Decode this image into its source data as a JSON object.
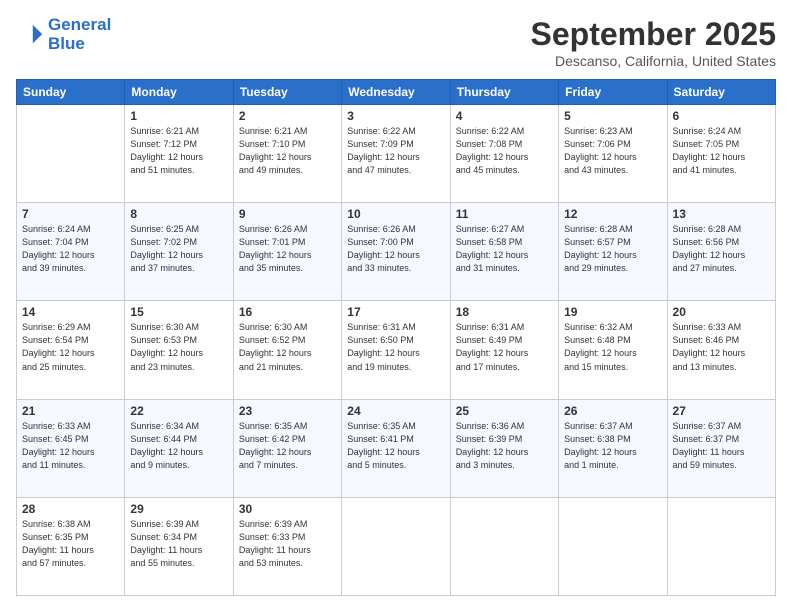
{
  "header": {
    "logo_line1": "General",
    "logo_line2": "Blue",
    "month": "September 2025",
    "location": "Descanso, California, United States"
  },
  "weekdays": [
    "Sunday",
    "Monday",
    "Tuesday",
    "Wednesday",
    "Thursday",
    "Friday",
    "Saturday"
  ],
  "weeks": [
    [
      {
        "day": "",
        "info": ""
      },
      {
        "day": "1",
        "info": "Sunrise: 6:21 AM\nSunset: 7:12 PM\nDaylight: 12 hours\nand 51 minutes."
      },
      {
        "day": "2",
        "info": "Sunrise: 6:21 AM\nSunset: 7:10 PM\nDaylight: 12 hours\nand 49 minutes."
      },
      {
        "day": "3",
        "info": "Sunrise: 6:22 AM\nSunset: 7:09 PM\nDaylight: 12 hours\nand 47 minutes."
      },
      {
        "day": "4",
        "info": "Sunrise: 6:22 AM\nSunset: 7:08 PM\nDaylight: 12 hours\nand 45 minutes."
      },
      {
        "day": "5",
        "info": "Sunrise: 6:23 AM\nSunset: 7:06 PM\nDaylight: 12 hours\nand 43 minutes."
      },
      {
        "day": "6",
        "info": "Sunrise: 6:24 AM\nSunset: 7:05 PM\nDaylight: 12 hours\nand 41 minutes."
      }
    ],
    [
      {
        "day": "7",
        "info": "Sunrise: 6:24 AM\nSunset: 7:04 PM\nDaylight: 12 hours\nand 39 minutes."
      },
      {
        "day": "8",
        "info": "Sunrise: 6:25 AM\nSunset: 7:02 PM\nDaylight: 12 hours\nand 37 minutes."
      },
      {
        "day": "9",
        "info": "Sunrise: 6:26 AM\nSunset: 7:01 PM\nDaylight: 12 hours\nand 35 minutes."
      },
      {
        "day": "10",
        "info": "Sunrise: 6:26 AM\nSunset: 7:00 PM\nDaylight: 12 hours\nand 33 minutes."
      },
      {
        "day": "11",
        "info": "Sunrise: 6:27 AM\nSunset: 6:58 PM\nDaylight: 12 hours\nand 31 minutes."
      },
      {
        "day": "12",
        "info": "Sunrise: 6:28 AM\nSunset: 6:57 PM\nDaylight: 12 hours\nand 29 minutes."
      },
      {
        "day": "13",
        "info": "Sunrise: 6:28 AM\nSunset: 6:56 PM\nDaylight: 12 hours\nand 27 minutes."
      }
    ],
    [
      {
        "day": "14",
        "info": "Sunrise: 6:29 AM\nSunset: 6:54 PM\nDaylight: 12 hours\nand 25 minutes."
      },
      {
        "day": "15",
        "info": "Sunrise: 6:30 AM\nSunset: 6:53 PM\nDaylight: 12 hours\nand 23 minutes."
      },
      {
        "day": "16",
        "info": "Sunrise: 6:30 AM\nSunset: 6:52 PM\nDaylight: 12 hours\nand 21 minutes."
      },
      {
        "day": "17",
        "info": "Sunrise: 6:31 AM\nSunset: 6:50 PM\nDaylight: 12 hours\nand 19 minutes."
      },
      {
        "day": "18",
        "info": "Sunrise: 6:31 AM\nSunset: 6:49 PM\nDaylight: 12 hours\nand 17 minutes."
      },
      {
        "day": "19",
        "info": "Sunrise: 6:32 AM\nSunset: 6:48 PM\nDaylight: 12 hours\nand 15 minutes."
      },
      {
        "day": "20",
        "info": "Sunrise: 6:33 AM\nSunset: 6:46 PM\nDaylight: 12 hours\nand 13 minutes."
      }
    ],
    [
      {
        "day": "21",
        "info": "Sunrise: 6:33 AM\nSunset: 6:45 PM\nDaylight: 12 hours\nand 11 minutes."
      },
      {
        "day": "22",
        "info": "Sunrise: 6:34 AM\nSunset: 6:44 PM\nDaylight: 12 hours\nand 9 minutes."
      },
      {
        "day": "23",
        "info": "Sunrise: 6:35 AM\nSunset: 6:42 PM\nDaylight: 12 hours\nand 7 minutes."
      },
      {
        "day": "24",
        "info": "Sunrise: 6:35 AM\nSunset: 6:41 PM\nDaylight: 12 hours\nand 5 minutes."
      },
      {
        "day": "25",
        "info": "Sunrise: 6:36 AM\nSunset: 6:39 PM\nDaylight: 12 hours\nand 3 minutes."
      },
      {
        "day": "26",
        "info": "Sunrise: 6:37 AM\nSunset: 6:38 PM\nDaylight: 12 hours\nand 1 minute."
      },
      {
        "day": "27",
        "info": "Sunrise: 6:37 AM\nSunset: 6:37 PM\nDaylight: 11 hours\nand 59 minutes."
      }
    ],
    [
      {
        "day": "28",
        "info": "Sunrise: 6:38 AM\nSunset: 6:35 PM\nDaylight: 11 hours\nand 57 minutes."
      },
      {
        "day": "29",
        "info": "Sunrise: 6:39 AM\nSunset: 6:34 PM\nDaylight: 11 hours\nand 55 minutes."
      },
      {
        "day": "30",
        "info": "Sunrise: 6:39 AM\nSunset: 6:33 PM\nDaylight: 11 hours\nand 53 minutes."
      },
      {
        "day": "",
        "info": ""
      },
      {
        "day": "",
        "info": ""
      },
      {
        "day": "",
        "info": ""
      },
      {
        "day": "",
        "info": ""
      }
    ]
  ]
}
